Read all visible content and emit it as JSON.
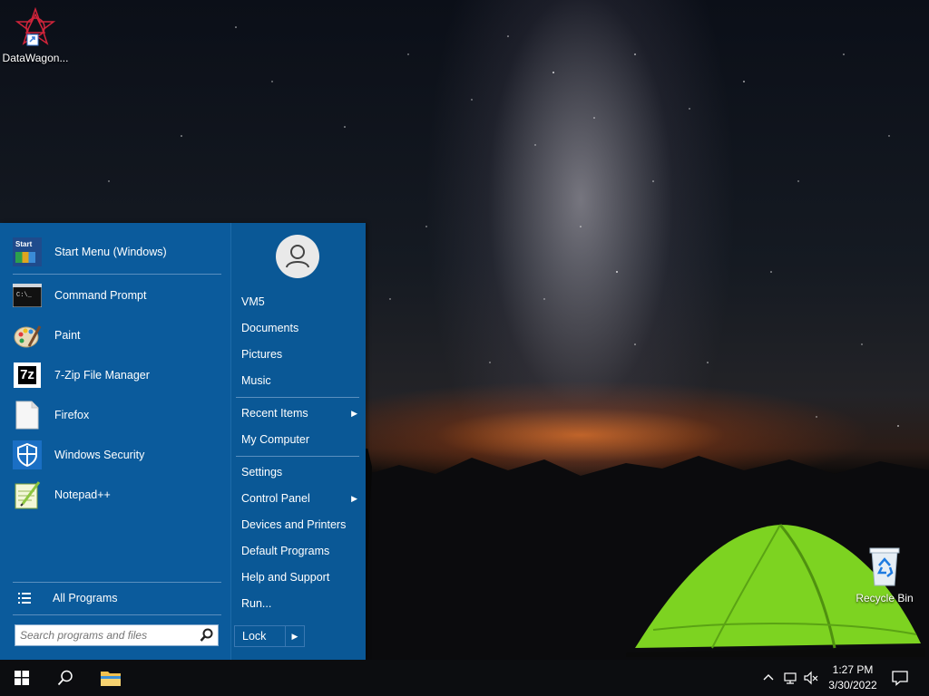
{
  "desktop": {
    "icons": [
      {
        "label": "DataWagon..."
      },
      {
        "label": "Recycle Bin"
      }
    ]
  },
  "start_menu": {
    "pinned": {
      "label": "Start Menu (Windows)",
      "icon_text": "Start"
    },
    "programs": [
      {
        "label": "Command Prompt",
        "icon": "cmd-icon"
      },
      {
        "label": "Paint",
        "icon": "paint-icon"
      },
      {
        "label": "7-Zip File Manager",
        "icon": "7zip-icon",
        "icon_text": "7z"
      },
      {
        "label": "Firefox",
        "icon": "file-icon"
      },
      {
        "label": "Windows Security",
        "icon": "shield-icon"
      },
      {
        "label": "Notepad++",
        "icon": "notepad-icon"
      }
    ],
    "all_programs": "All Programs",
    "search": {
      "placeholder": "Search programs and files"
    },
    "right": {
      "items": [
        {
          "label": "VM5"
        },
        {
          "label": "Documents"
        },
        {
          "label": "Pictures"
        },
        {
          "label": "Music"
        },
        {
          "label": "Recent Items",
          "submenu": "▶"
        },
        {
          "label": "My Computer"
        },
        {
          "label": "Settings"
        },
        {
          "label": "Control Panel",
          "submenu": "▶"
        },
        {
          "label": "Devices and Printers"
        },
        {
          "label": "Default Programs"
        },
        {
          "label": "Help and Support"
        },
        {
          "label": "Run..."
        }
      ],
      "lock": "Lock",
      "lock_arrow": "▶"
    }
  },
  "taskbar": {
    "time": "1:27 PM",
    "date": "3/30/2022"
  },
  "colors": {
    "menu_bg": "#0b5b9c",
    "taskbar_bg": "#0c0d10",
    "tent_green": "#7dd321"
  }
}
